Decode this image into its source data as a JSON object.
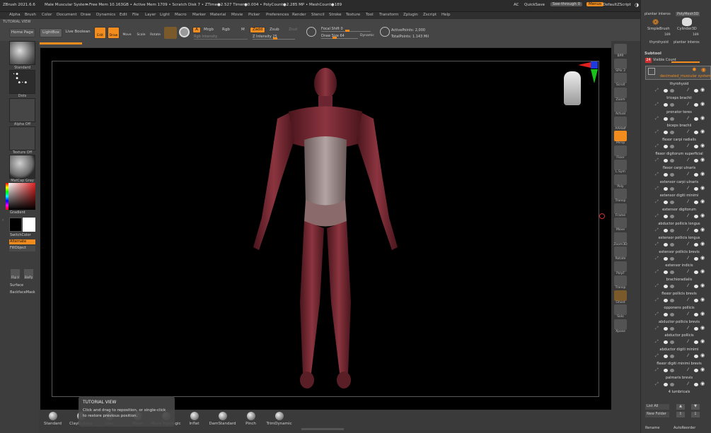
{
  "titlebar": {
    "app": "ZBrush 2021.6.6",
    "doc": "Male Muscular System",
    "stats": "• Free Mem 10.163GB • Active Mem 1709 • Scratch Disk 7 • ZTime●2.527 Timer●0.004 • PolyCount●2.285 MP • MeshCount●189",
    "ac": "AC",
    "quicksave": "QuickSave",
    "seethrough": "See-through  0",
    "menus": "Menus",
    "defaultzscript": "DefaultZScript"
  },
  "menubar": [
    "Alpha",
    "Brush",
    "Color",
    "Document",
    "Draw",
    "Dynamics",
    "Edit",
    "File",
    "Layer",
    "Light",
    "Macro",
    "Marker",
    "Material",
    "Movie",
    "Picker",
    "Preferences",
    "Render",
    "Stencil",
    "Stroke",
    "Texture",
    "Tool",
    "Transform",
    "Zplugin",
    "Zscript",
    "Help"
  ],
  "tutorial_label": "TUTORIAL VIEW",
  "toolbar": {
    "home": "Home Page",
    "lightbox": "LightBox",
    "liveboolean": "Live Boolean",
    "edit": "Edit",
    "draw": "Draw",
    "move": "Move",
    "scale": "Scale",
    "rotate": "Rotate",
    "a": "A",
    "mrgb": "Mrgb",
    "rgb": "Rgb",
    "m": "M",
    "zadd": "Zadd",
    "zsub": "Zsub",
    "zcut": "Zcut",
    "rgb_intensity": "Rgb Intensity",
    "z_intensity": "Z Intensity 25",
    "focal_shift": "Focal Shift 0",
    "draw_size": "Draw Size 64",
    "dynamic": "Dynamic",
    "active_points": "ActivePoints: 2,000",
    "total_points": "TotalPoints: 1.143 Mil"
  },
  "left": {
    "standard": "Standard",
    "dots": "Dots",
    "alpha_off": "Alpha Off",
    "texture_off": "Texture Off",
    "matcap": "MatCap Gray",
    "gradient": "Gradient",
    "switchcolor": "SwitchColor",
    "alternate": "Alternate",
    "fillobject": "FillObject",
    "flipv": "Flip V",
    "bivpy": "BivPy",
    "surface": "Surface",
    "backfacemask": "BackfaceMask"
  },
  "rightshelf": [
    "BPR",
    "SPix 3",
    "Scroll",
    "Zoom",
    "Actual",
    "AAHalf",
    "Persp",
    "Floor",
    "L.Sym",
    "Poly",
    "Transp",
    "Frame",
    "Move",
    "Zoom3D",
    "Rotate",
    "PolyF",
    "Transp",
    "Ghost",
    "Solo",
    "Xpose"
  ],
  "tray": {
    "top_tools": [
      "plantar interos",
      "PolyMesh3D",
      "SimpleBrush",
      "Cylinder3D",
      "189",
      "thyrohyoid",
      "plantar interos"
    ],
    "subtool_title": "Subtool",
    "visible_count_num": "24",
    "visible_count": "Visible Count",
    "selected": "decimated_muscular system",
    "items": [
      "thyrohyoid",
      "triceps brachii",
      "pronator teres",
      "biceps brachii",
      "flexor carpi radialis",
      "flexor digitorum superficial",
      "flexor carpi ulnaris",
      "extensor carpi ulnaris",
      "extensor digiti minimi",
      "extensor digitorum",
      "abductor pollicis longus",
      "extensor pollicis longus",
      "extensor pollicis brevis",
      "extensor indicis",
      "brachioradialis",
      "flexor pollicis brevis",
      "opponens pollicis",
      "abductor pollicis brevis",
      "abductor pollicis",
      "abductor digiti minimi",
      "flexor digiti minimi brevis",
      "palmaris brevis",
      "4 lumbricals"
    ],
    "list_all": "List All",
    "new_folder": "New Folder",
    "rename": "Rename",
    "autoreorder": "AutoReorder"
  },
  "tooltip": {
    "title": "TUTORIAL VIEW",
    "line1": "Click and drag to reposition, or single-click",
    "line2": "to restore previous position."
  },
  "brushes": [
    "Standard",
    "ClayBuildup",
    "clay",
    "Move",
    "Move Topologic",
    "Inflat",
    "DamStandard",
    "Pinch",
    "TrimDynamic"
  ],
  "colors": {
    "accent": "#f28c1e",
    "muscle": "#7a2a33",
    "axis_red": "#e01f1f",
    "axis_green": "#18c218",
    "axis_blue": "#1f3be0"
  }
}
